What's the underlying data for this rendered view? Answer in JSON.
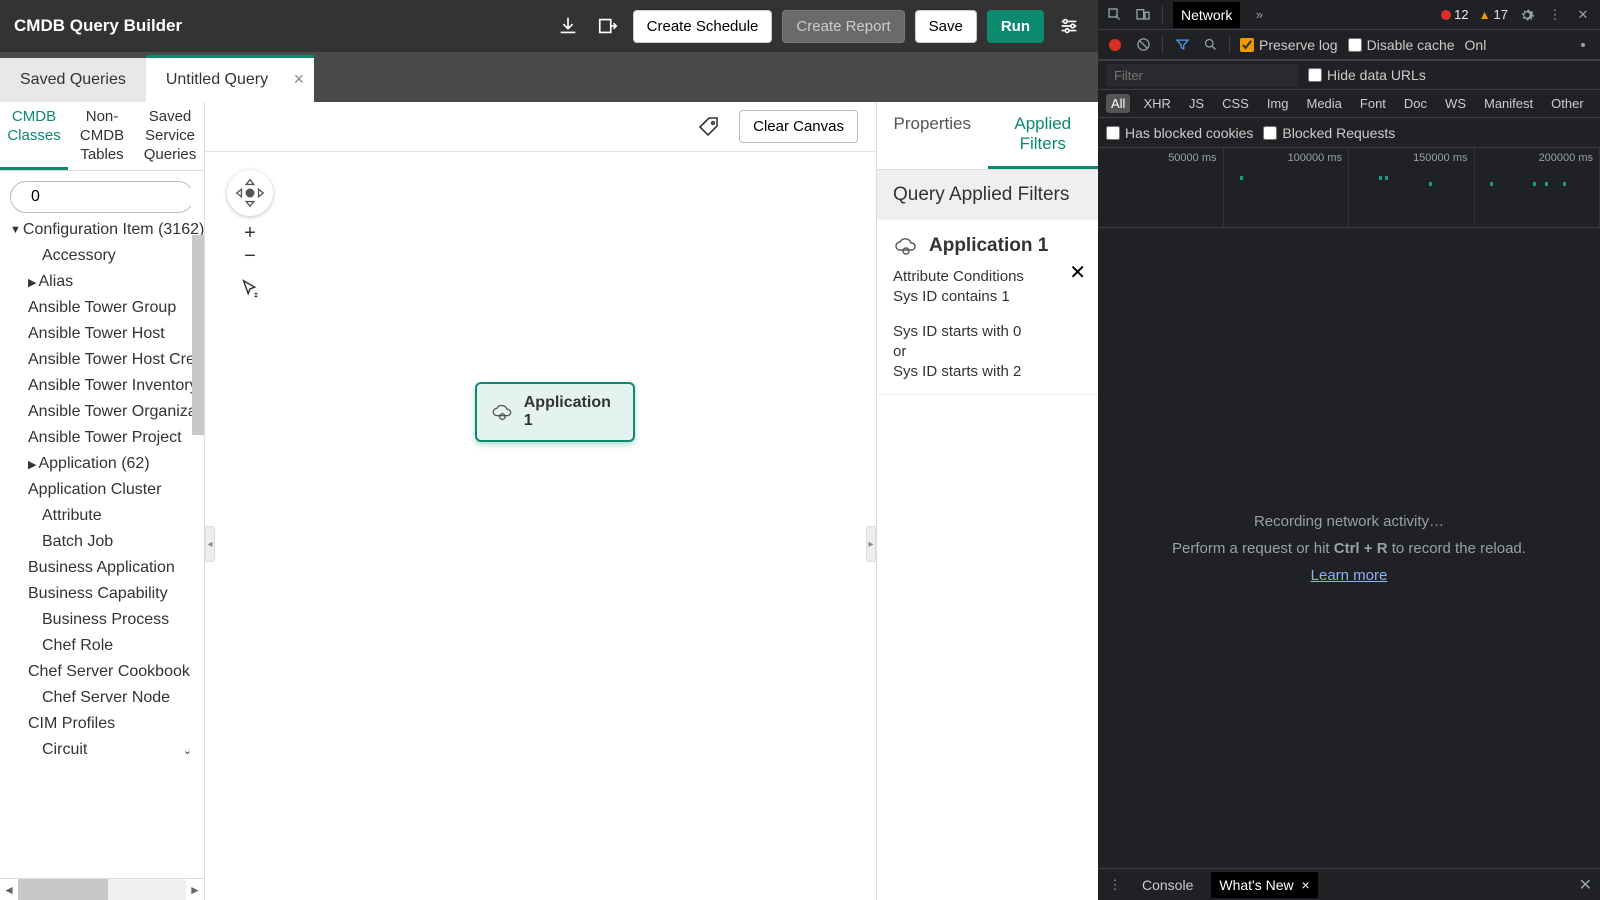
{
  "header": {
    "title": "CMDB Query Builder",
    "create_schedule": "Create Schedule",
    "create_report": "Create Report",
    "save": "Save",
    "run": "Run"
  },
  "tabs": {
    "saved": "Saved Queries",
    "untitled": "Untitled Query"
  },
  "sidebar": {
    "tabs": {
      "cmdb": "CMDB Classes",
      "non_cmdb": "Non-CMDB Tables",
      "saved_service": "Saved Service Queries"
    },
    "search_value": "0",
    "tree": {
      "root": "Configuration Item (3162)",
      "items": [
        "Accessory",
        "Alias",
        "Ansible Tower Group",
        "Ansible Tower Host",
        "Ansible Tower Host Credential",
        "Ansible Tower Inventory",
        "Ansible Tower Organization",
        "Ansible Tower Project",
        "Application (62)",
        "Application Cluster",
        "Attribute",
        "Batch Job",
        "Business Application",
        "Business Capability",
        "Business Process",
        "Chef Role",
        "Chef Server Cookbook",
        "Chef Server Node",
        "CIM Profiles",
        "Circuit"
      ]
    }
  },
  "canvas": {
    "clear": "Clear Canvas",
    "node_label": "Application 1"
  },
  "right": {
    "tabs": {
      "properties": "Properties",
      "applied": "Applied Filters"
    },
    "header": "Query Applied Filters",
    "filter": {
      "title": "Application 1",
      "attr_cond": "Attribute Conditions",
      "line1": "Sys ID contains 1",
      "line2": "Sys ID starts with 0",
      "or": "or",
      "line3": "Sys ID starts with 2"
    }
  },
  "devtools": {
    "tab": "Network",
    "errors": "12",
    "warnings": "17",
    "preserve_log": "Preserve log",
    "disable_cache": "Disable cache",
    "online": "Onl",
    "filter_placeholder": "Filter",
    "hide_data_urls": "Hide data URLs",
    "types": [
      "All",
      "XHR",
      "JS",
      "CSS",
      "Img",
      "Media",
      "Font",
      "Doc",
      "WS",
      "Manifest",
      "Other"
    ],
    "has_blocked": "Has blocked cookies",
    "blocked_req": "Blocked Requests",
    "ticks": [
      "50000 ms",
      "100000 ms",
      "150000 ms",
      "200000 ms"
    ],
    "empty": {
      "l1": "Recording network activity…",
      "l2a": "Perform a request or hit ",
      "l2b": "Ctrl + R",
      "l2c": " to record the reload.",
      "learn": "Learn more"
    },
    "bottom": {
      "console": "Console",
      "whatsnew": "What's New"
    }
  }
}
